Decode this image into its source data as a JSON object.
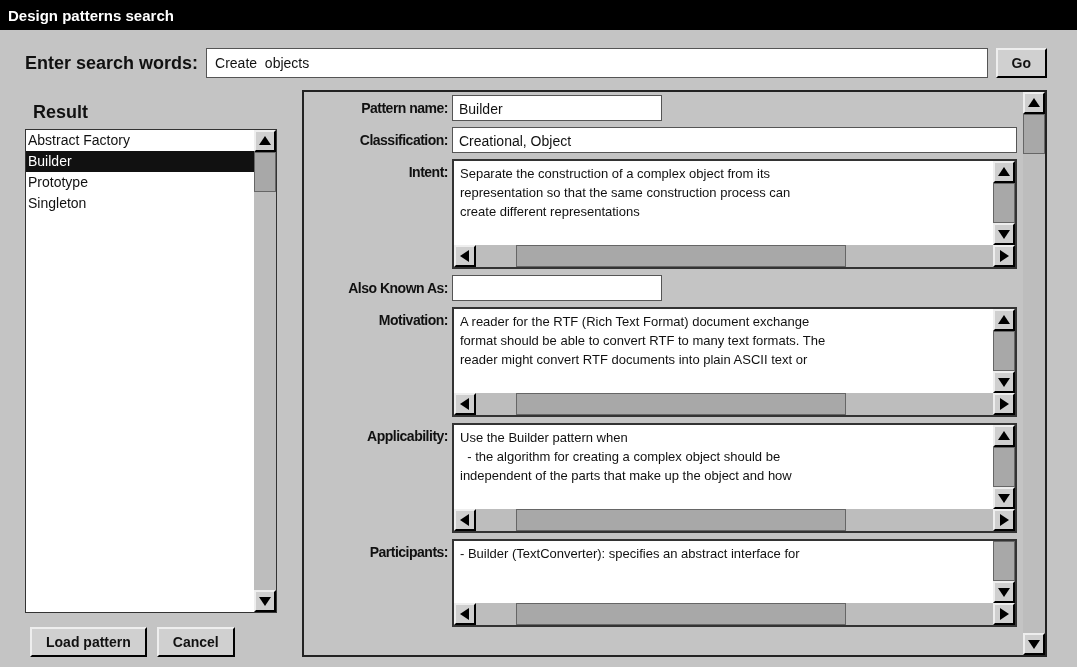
{
  "window": {
    "title": "Design patterns search"
  },
  "search": {
    "label": "Enter search words:",
    "value": "Create  objects",
    "button": "Go"
  },
  "result": {
    "label": "Result",
    "items": [
      {
        "label": "Abstract Factory",
        "selected": false
      },
      {
        "label": "Builder",
        "selected": true
      },
      {
        "label": "Prototype",
        "selected": false
      },
      {
        "label": "Singleton",
        "selected": false
      }
    ],
    "buttons": [
      "Load pattern",
      "Cancel"
    ]
  },
  "fields": [
    {
      "label": "Pattern name:",
      "kind": "short",
      "lines": [
        "Builder"
      ]
    },
    {
      "label": "Classification:",
      "kind": "line",
      "lines": [
        "Creational, Object"
      ]
    },
    {
      "label": "Intent:",
      "kind": "text",
      "lines": [
        "Separate the construction of a complex object from its",
        "representation so that the same construction process can",
        "create different representations"
      ]
    },
    {
      "label": "Also Known As:",
      "kind": "short"
    },
    {
      "label": "Motivation:",
      "kind": "text",
      "lines": [
        "A reader for the RTF (Rich Text Format) document exchange",
        "format should be able to convert RTF to many text formats. The",
        "reader might convert RTF documents into plain ASCII text or"
      ]
    },
    {
      "label": "Applicability:",
      "kind": "text",
      "lines": [
        "Use the Builder pattern when",
        "  - the algorithm for creating a complex object should be",
        "independent of the parts that make up the object and how"
      ]
    },
    {
      "label": "Participants:",
      "kind": "clipped",
      "lines": [
        "- Builder (TextConverter): specifies an abstract interface for"
      ]
    }
  ]
}
